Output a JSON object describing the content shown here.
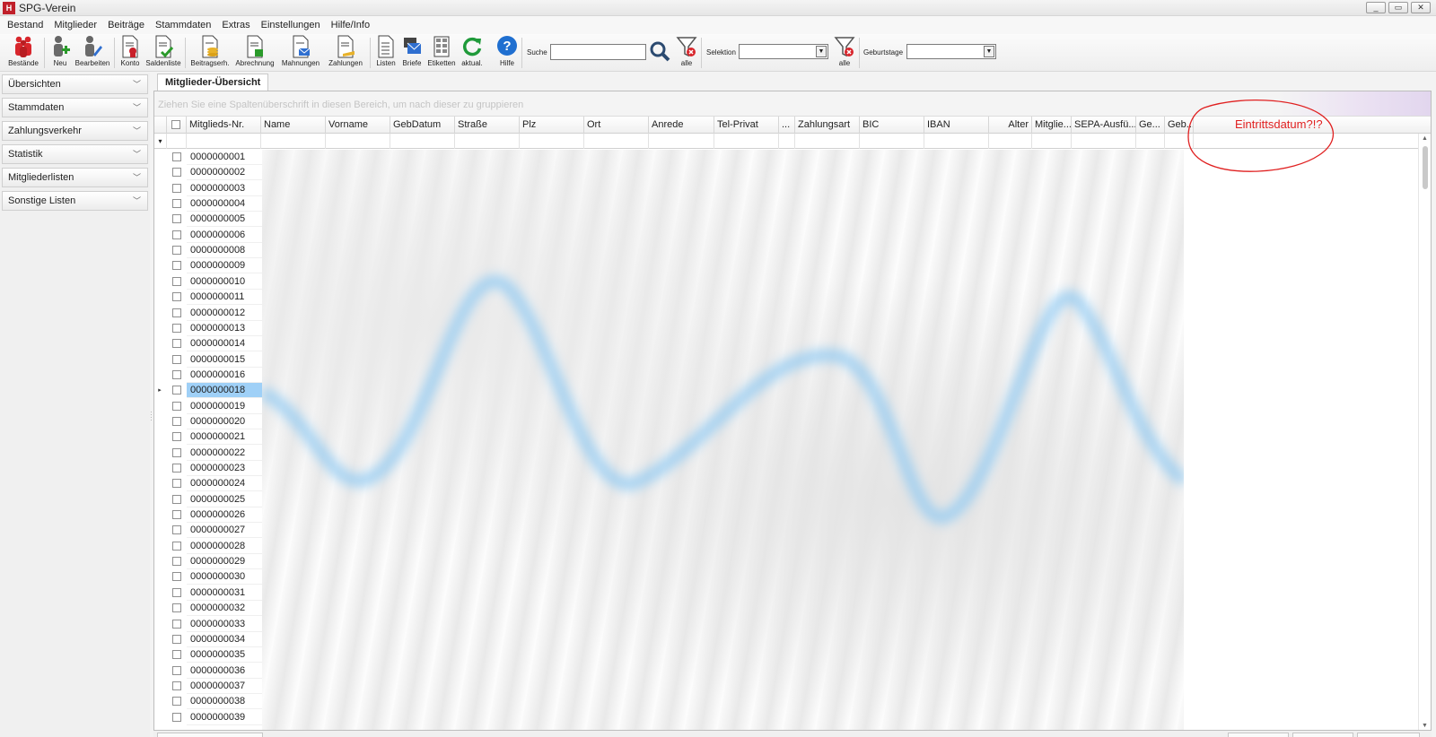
{
  "window": {
    "title": "SPG-Verein",
    "logo_text": "H",
    "minimize": "_",
    "restore": "▭",
    "close": "✕"
  },
  "menu": [
    "Bestand",
    "Mitglieder",
    "Beiträge",
    "Stammdaten",
    "Extras",
    "Einstellungen",
    "Hilfe/Info"
  ],
  "toolbar": {
    "buttons": [
      {
        "label": "Bestände",
        "icon": "members-icon"
      },
      {
        "label": "Neu",
        "icon": "add-member-icon"
      },
      {
        "label": "Bearbeiten",
        "icon": "edit-member-icon"
      },
      {
        "label": "Konto",
        "icon": "account-icon"
      },
      {
        "label": "Saldenliste",
        "icon": "balance-list-icon"
      },
      {
        "label": "Beitragserh.",
        "icon": "contribution-icon"
      },
      {
        "label": "Abrechnung",
        "icon": "billing-icon"
      },
      {
        "label": "Mahnungen",
        "icon": "reminder-icon"
      },
      {
        "label": "Zahlungen",
        "icon": "payments-icon"
      },
      {
        "label": "Listen",
        "icon": "lists-icon"
      },
      {
        "label": "Briefe",
        "icon": "letters-icon"
      },
      {
        "label": "Etiketten",
        "icon": "labels-icon"
      },
      {
        "label": "aktual.",
        "icon": "refresh-icon"
      },
      {
        "label": "Hilfe",
        "icon": "help-icon"
      }
    ],
    "search_label": "Suche",
    "search_value": "",
    "filter_all_label": "alle",
    "selection_label": "Selektion",
    "selection_value": "",
    "filter_all_label_2": "alle",
    "birthdays_label": "Geburtstage",
    "birthdays_value": ""
  },
  "sidebar": {
    "items": [
      {
        "label": "Übersichten"
      },
      {
        "label": "Stammdaten"
      },
      {
        "label": "Zahlungsverkehr"
      },
      {
        "label": "Statistik"
      },
      {
        "label": "Mitgliederlisten"
      },
      {
        "label": "Sonstige Listen"
      }
    ]
  },
  "tab": {
    "label": "Mitglieder-Übersicht"
  },
  "grid": {
    "group_hint": "Ziehen Sie eine Spaltenüberschrift in diesen Bereich, um nach dieser zu gruppieren",
    "columns": [
      "Mitglieds-Nr.",
      "Name",
      "Vorname",
      "GebDatum",
      "Straße",
      "Plz",
      "Ort",
      "Anrede",
      "Tel-Privat",
      "...",
      "Zahlungsart",
      "BIC",
      "IBAN",
      "Alter",
      "Mitglie...",
      "SEPA-Ausfü...",
      "Ge...",
      "Geb..."
    ],
    "rows": [
      "0000000001",
      "0000000002",
      "0000000003",
      "0000000004",
      "0000000005",
      "0000000006",
      "0000000008",
      "0000000009",
      "0000000010",
      "0000000011",
      "0000000012",
      "0000000013",
      "0000000014",
      "0000000015",
      "0000000016",
      "0000000018",
      "0000000019",
      "0000000020",
      "0000000021",
      "0000000022",
      "0000000023",
      "0000000024",
      "0000000025",
      "0000000026",
      "0000000027",
      "0000000028",
      "0000000029",
      "0000000030",
      "0000000031",
      "0000000032",
      "0000000033",
      "0000000034",
      "0000000035",
      "0000000036",
      "0000000037",
      "0000000038",
      "0000000039"
    ],
    "selected_row": "0000000018"
  },
  "annotation": {
    "text": "Eintrittsdatum?!?",
    "color": "#e02020"
  }
}
